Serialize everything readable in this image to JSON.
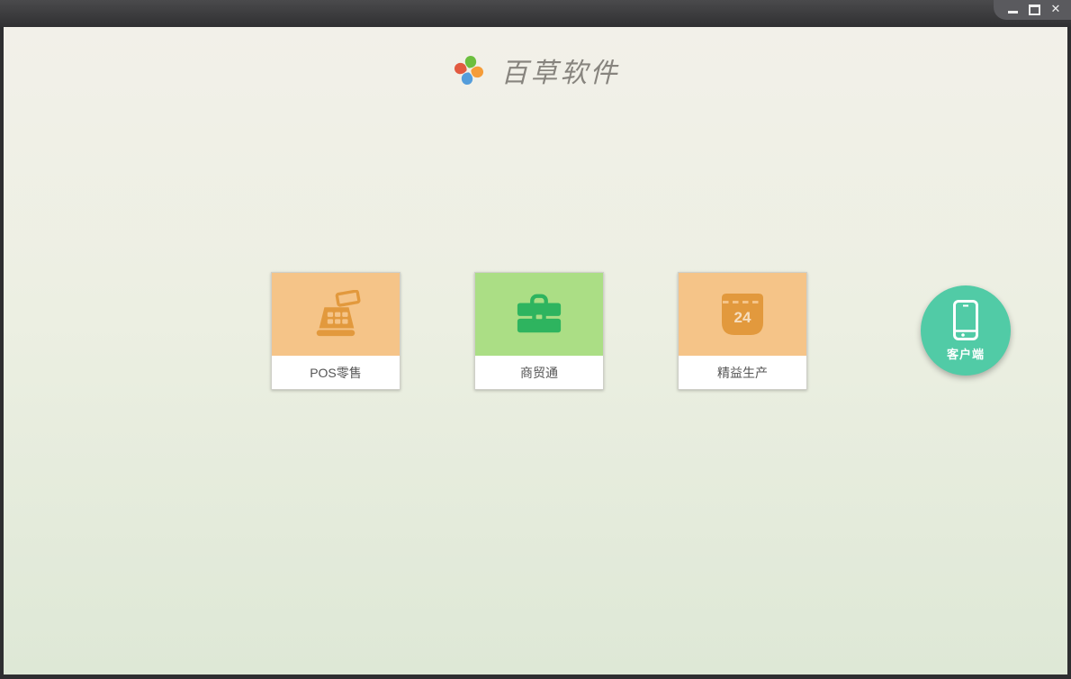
{
  "titlebar": {
    "buttons": [
      {
        "name": "minimize"
      },
      {
        "name": "maximize"
      },
      {
        "name": "close"
      }
    ]
  },
  "header": {
    "app_title": "百草软件"
  },
  "products": [
    {
      "label": "POS零售",
      "icon": "cash-register-icon",
      "tile_color": "#f5c488",
      "icon_color": "#e2993d"
    },
    {
      "label": "商贸通",
      "icon": "briefcase-icon",
      "tile_color": "#abde85",
      "icon_color": "#2eb45f"
    },
    {
      "label": "精益生产",
      "icon": "calendar-icon",
      "tile_color": "#f5c488",
      "icon_color": "#e2993d",
      "calendar_day": "24"
    }
  ],
  "client_button": {
    "label": "客户端",
    "icon": "smartphone-icon",
    "color": "#51cba6"
  },
  "logo": {
    "name": "pinwheel-logo",
    "petal_colors": {
      "top": "#6cbf3f",
      "right": "#f59c38",
      "bottom": "#549ddb",
      "left": "#e25a40"
    }
  },
  "theme": {
    "background_top": "#f2f0e9",
    "background_bottom": "#dee8d6",
    "titlebar_color": "#3a3a3c",
    "label_text": "#555555"
  }
}
